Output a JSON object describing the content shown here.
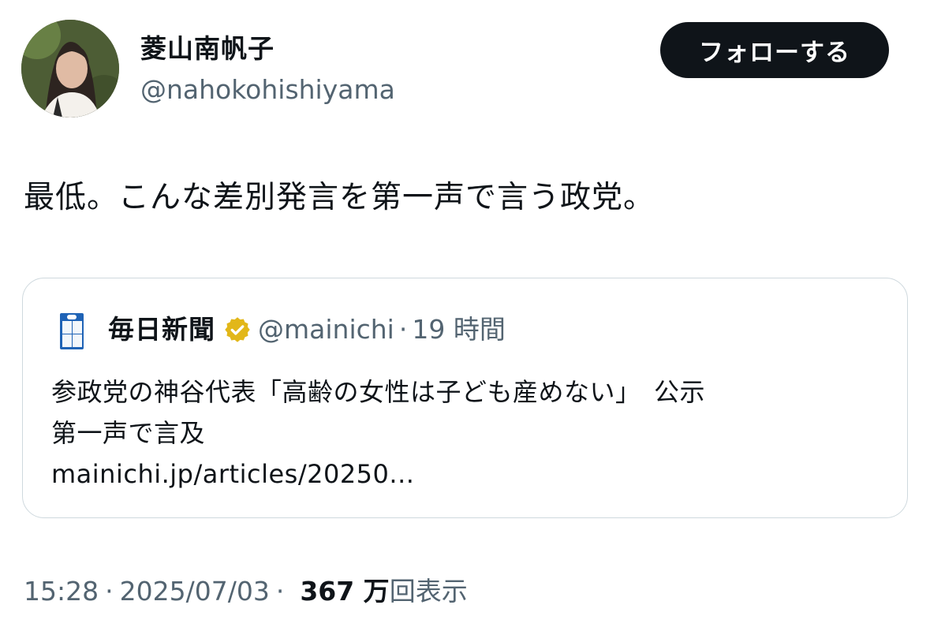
{
  "author": {
    "display_name": "菱山南帆子",
    "handle": "@nahokohishiyama"
  },
  "follow_button": {
    "label": "フォローする"
  },
  "tweet": {
    "text": "最低。こんな差別発言を第一声で言う政党。"
  },
  "quote": {
    "display_name": "毎日新聞",
    "verified_badge_icon": "gold-verified-badge-icon",
    "handle": "@mainichi",
    "separator": "·",
    "time_ago": "19 時間",
    "text_line1": "参政党の神谷代表「高齢の女性は子ども産めない」　公示",
    "text_line2": "第一声で言及",
    "link": "mainichi.jp/articles/20250..."
  },
  "meta": {
    "time": "15:28",
    "sep1": "·",
    "date": "2025/07/03",
    "sep2": "·",
    "views_count": "367 万",
    "views_label": "回表示"
  },
  "colors": {
    "primary_text": "#0f1419",
    "secondary_text": "#536471",
    "border": "#cfd9de",
    "follow_bg": "#0f1419",
    "badge_gold": "#e2b719"
  }
}
